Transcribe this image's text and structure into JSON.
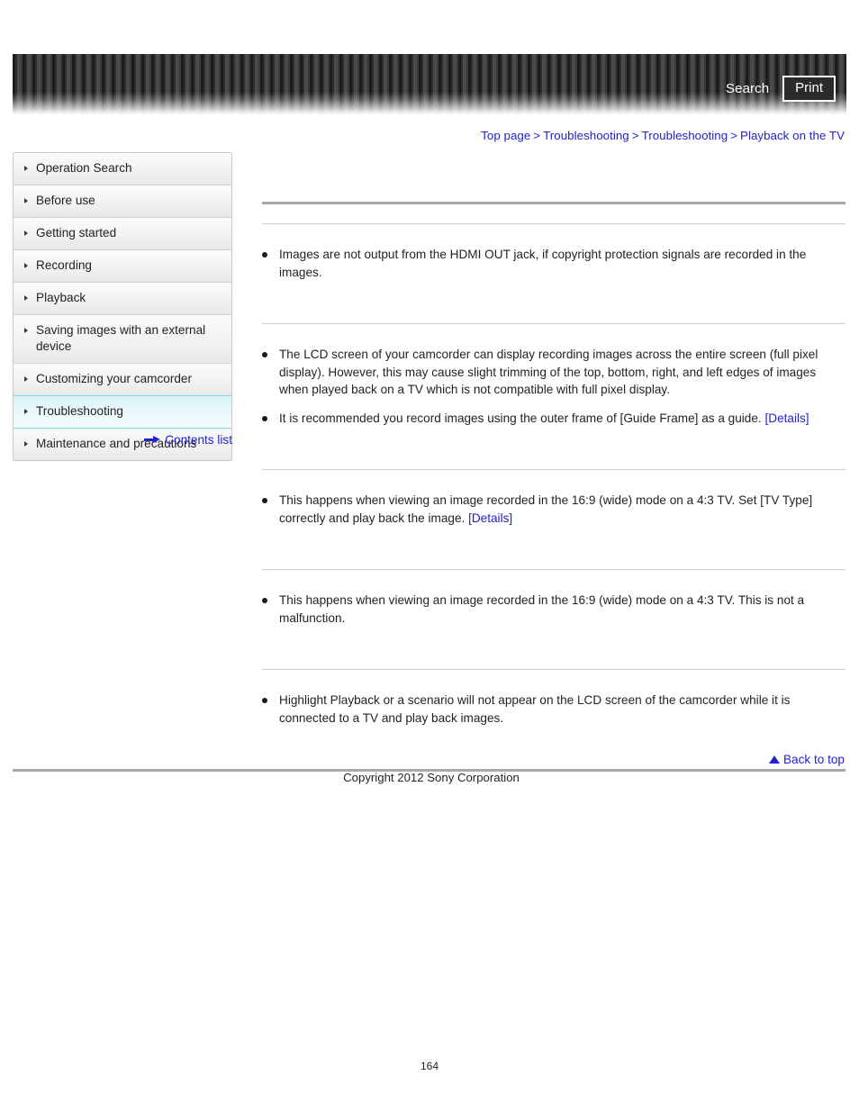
{
  "header": {
    "search_label": "Search",
    "print_label": "Print"
  },
  "breadcrumb": {
    "separator": ">",
    "items": [
      {
        "label": "Top page"
      },
      {
        "label": "Troubleshooting"
      },
      {
        "label": "Troubleshooting"
      },
      {
        "label": "Playback on the TV"
      }
    ]
  },
  "sidebar": {
    "items": [
      {
        "label": "Operation Search",
        "active": false
      },
      {
        "label": "Before use",
        "active": false
      },
      {
        "label": "Getting started",
        "active": false
      },
      {
        "label": "Recording",
        "active": false
      },
      {
        "label": "Playback",
        "active": false
      },
      {
        "label": "Saving images with an external device",
        "active": false
      },
      {
        "label": "Customizing your camcorder",
        "active": false
      },
      {
        "label": "Troubleshooting",
        "active": true
      },
      {
        "label": "Maintenance and precautions",
        "active": false
      }
    ],
    "contents_list_label": "Contents list"
  },
  "main": {
    "page_title": "",
    "sections": [
      {
        "heading": "",
        "bullets": [
          {
            "text": "Images are not output from the HDMI OUT jack, if copyright protection signals are recorded in the images.",
            "link": ""
          }
        ]
      },
      {
        "heading": "",
        "bullets": [
          {
            "text": "The LCD screen of your camcorder can display recording images across the entire screen (full pixel display). However, this may cause slight trimming of the top, bottom, right, and left edges of images when played back on a TV which is not compatible with full pixel display.",
            "link": ""
          },
          {
            "text": "It is recommended you record images using the outer frame of [Guide Frame] as a guide. ",
            "link": "[Details]"
          }
        ]
      },
      {
        "heading": "",
        "bullets": [
          {
            "text": "This happens when viewing an image recorded in the 16:9 (wide) mode on a 4:3 TV. Set [TV Type] correctly and play back the image. ",
            "link": "[Details]"
          }
        ]
      },
      {
        "heading": "",
        "bullets": [
          {
            "text": "This happens when viewing an image recorded in the 16:9 (wide) mode on a 4:3 TV. This is not a malfunction.",
            "link": ""
          }
        ]
      },
      {
        "heading": "",
        "bullets": [
          {
            "text": "Highlight Playback or a scenario will not appear on the LCD screen of the camcorder while it is connected to a TV and play back images.",
            "link": ""
          }
        ]
      }
    ]
  },
  "footer": {
    "back_to_top_label": "Back to top",
    "copyright": "Copyright 2012 Sony Corporation",
    "page_number": "164"
  },
  "colors": {
    "link": "#2222cc",
    "active_nav": "#d9f3f8",
    "rule_major": "#a9a9a9",
    "rule_minor": "#cfcfcf"
  }
}
